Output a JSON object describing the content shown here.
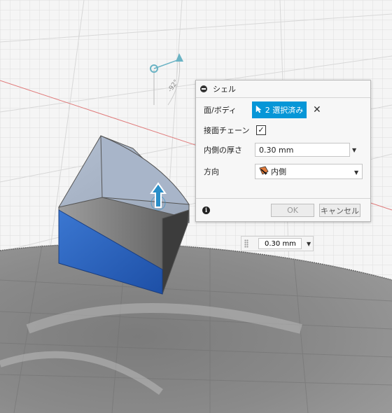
{
  "viewport": {
    "angle_label": "-92°"
  },
  "shell_dialog": {
    "title": "シェル",
    "faces_label": "面/ボディ",
    "selection_label": "2 選択済み",
    "tangent_chain_label": "接面チェーン",
    "tangent_chain_checked": true,
    "check_glyph": "✓",
    "inside_thickness_label": "内側の厚さ",
    "inside_thickness_value": "0.30 mm",
    "direction_label": "方向",
    "direction_value": "内側",
    "ok_label": "OK",
    "cancel_label": "キャンセル",
    "info_glyph": "i",
    "close_glyph": "✕"
  },
  "floating_input": {
    "value": "0.30 mm"
  },
  "icons": {
    "collapse": "minus-circle-icon",
    "cursor": "pointer-arrow-icon",
    "direction": "inside-direction-icon",
    "info": "info-icon",
    "dropdown": "triangle-down-icon"
  },
  "colors": {
    "selection_button": "#0696d7",
    "selected_face": "#2a65c2",
    "axis_red": "#e07a7a",
    "manipulator": "#2a8fc9"
  }
}
